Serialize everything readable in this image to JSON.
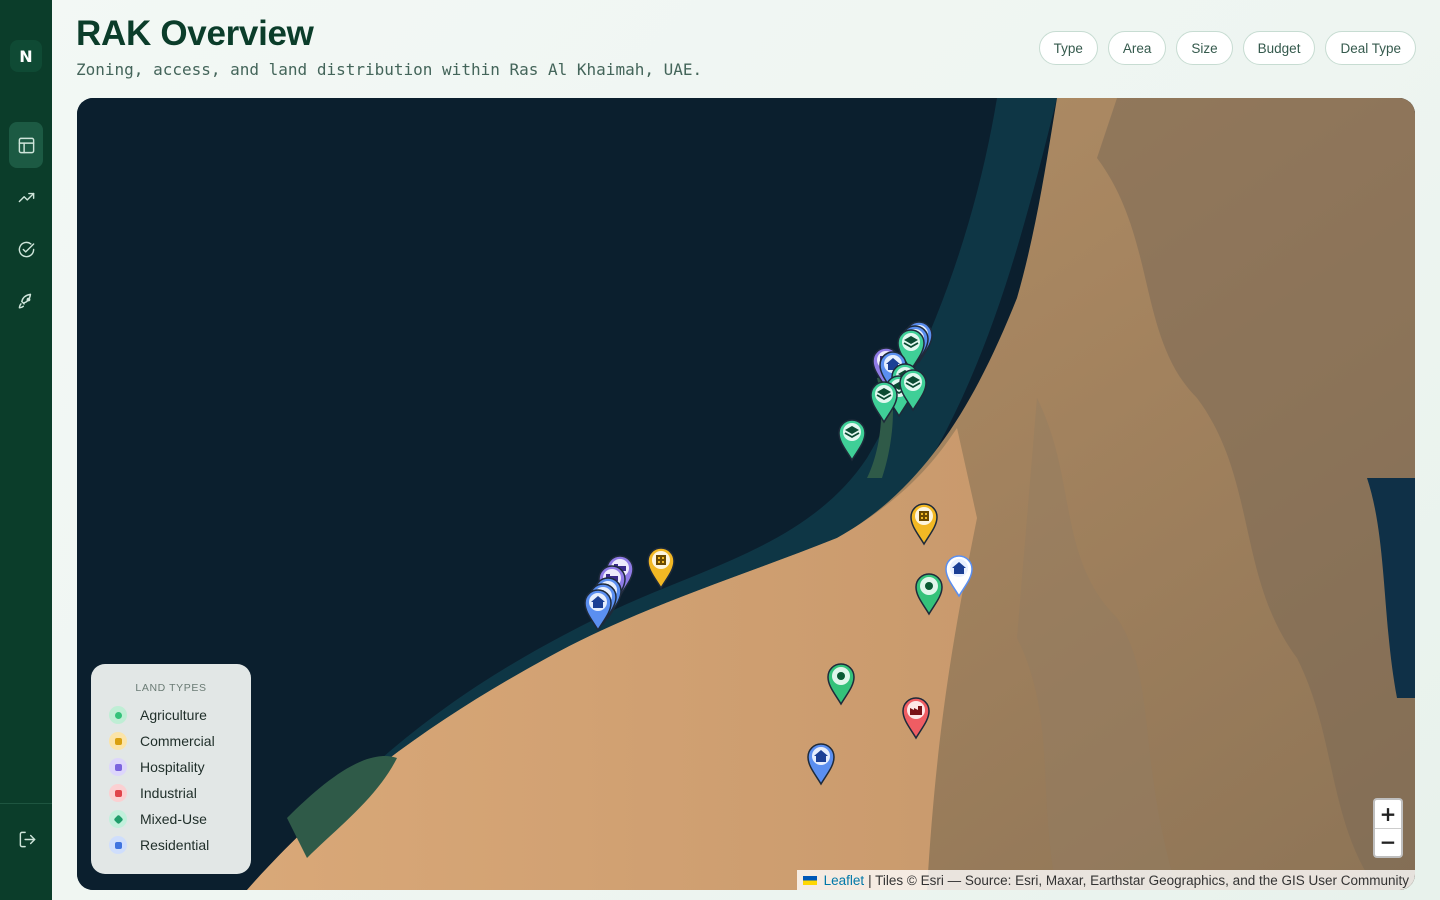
{
  "app": {
    "logo_glyph": "N"
  },
  "sidebar": {
    "items": [
      {
        "name": "layout",
        "icon": "layout-icon",
        "active": true
      },
      {
        "name": "trending",
        "icon": "trending-up-icon",
        "active": false
      },
      {
        "name": "check",
        "icon": "check-circle-icon",
        "active": false
      },
      {
        "name": "launch",
        "icon": "rocket-icon",
        "active": false
      }
    ],
    "logout_icon": "logout-icon"
  },
  "header": {
    "title": "RAK Overview",
    "subtitle": "Zoning, access, and land distribution within Ras Al Khaimah, UAE."
  },
  "filters": [
    "Type",
    "Area",
    "Size",
    "Budget",
    "Deal Type"
  ],
  "legend": {
    "title": "LAND TYPES",
    "items": [
      {
        "label": "Agriculture",
        "color": "#34c27a",
        "icon": "pin-icon"
      },
      {
        "label": "Commercial",
        "color": "#f2b824",
        "icon": "building-icon"
      },
      {
        "label": "Hospitality",
        "color": "#8f7be6",
        "icon": "bed-icon"
      },
      {
        "label": "Industrial",
        "color": "#ef5d63",
        "icon": "factory-icon"
      },
      {
        "label": "Mixed-Use",
        "color": "#3fcf97",
        "icon": "layers-icon"
      },
      {
        "label": "Residential",
        "color": "#5b8ff0",
        "icon": "home-icon"
      }
    ]
  },
  "map": {
    "zoom_in": "+",
    "zoom_out": "−",
    "attribution_link": "Leaflet",
    "attribution_text": "| Tiles © Esri — Source: Esri, Maxar, Earthstar Geographics, and the GIS User Community"
  }
}
